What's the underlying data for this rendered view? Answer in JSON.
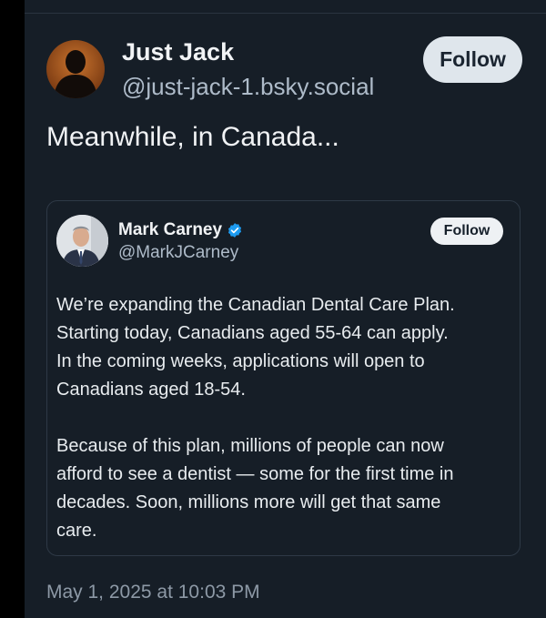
{
  "post": {
    "author": {
      "display_name": "Just Jack",
      "handle": "@just-jack-1.bsky.social",
      "avatar_icon": "silhouette-avatar"
    },
    "follow_label": "Follow",
    "text": "Meanwhile, in Canada...",
    "timestamp": "May 1, 2025 at 10:03 PM"
  },
  "quote": {
    "author": {
      "display_name": "Mark Carney",
      "handle": "@MarkJCarney",
      "verified": true,
      "verified_icon": "verified-badge-icon"
    },
    "follow_label": "Follow",
    "lines_p1": [
      "We’re expanding the Canadian Dental Care Plan.",
      "Starting today, Canadians aged 55-64 can apply.",
      "In the coming weeks, applications will open to",
      "Canadians aged 18-54."
    ],
    "lines_p2": [
      "Because of this plan, millions of people can now",
      "afford to see a dentist — some for the first time in",
      "decades. Soon, millions more will get that same",
      "care."
    ]
  },
  "colors": {
    "background": "#161e27",
    "text_primary": "#f1f3f5",
    "text_secondary": "#aebbc9",
    "verified_blue": "#1d9bf0",
    "follow_button_bg": "#dfe6ec"
  }
}
